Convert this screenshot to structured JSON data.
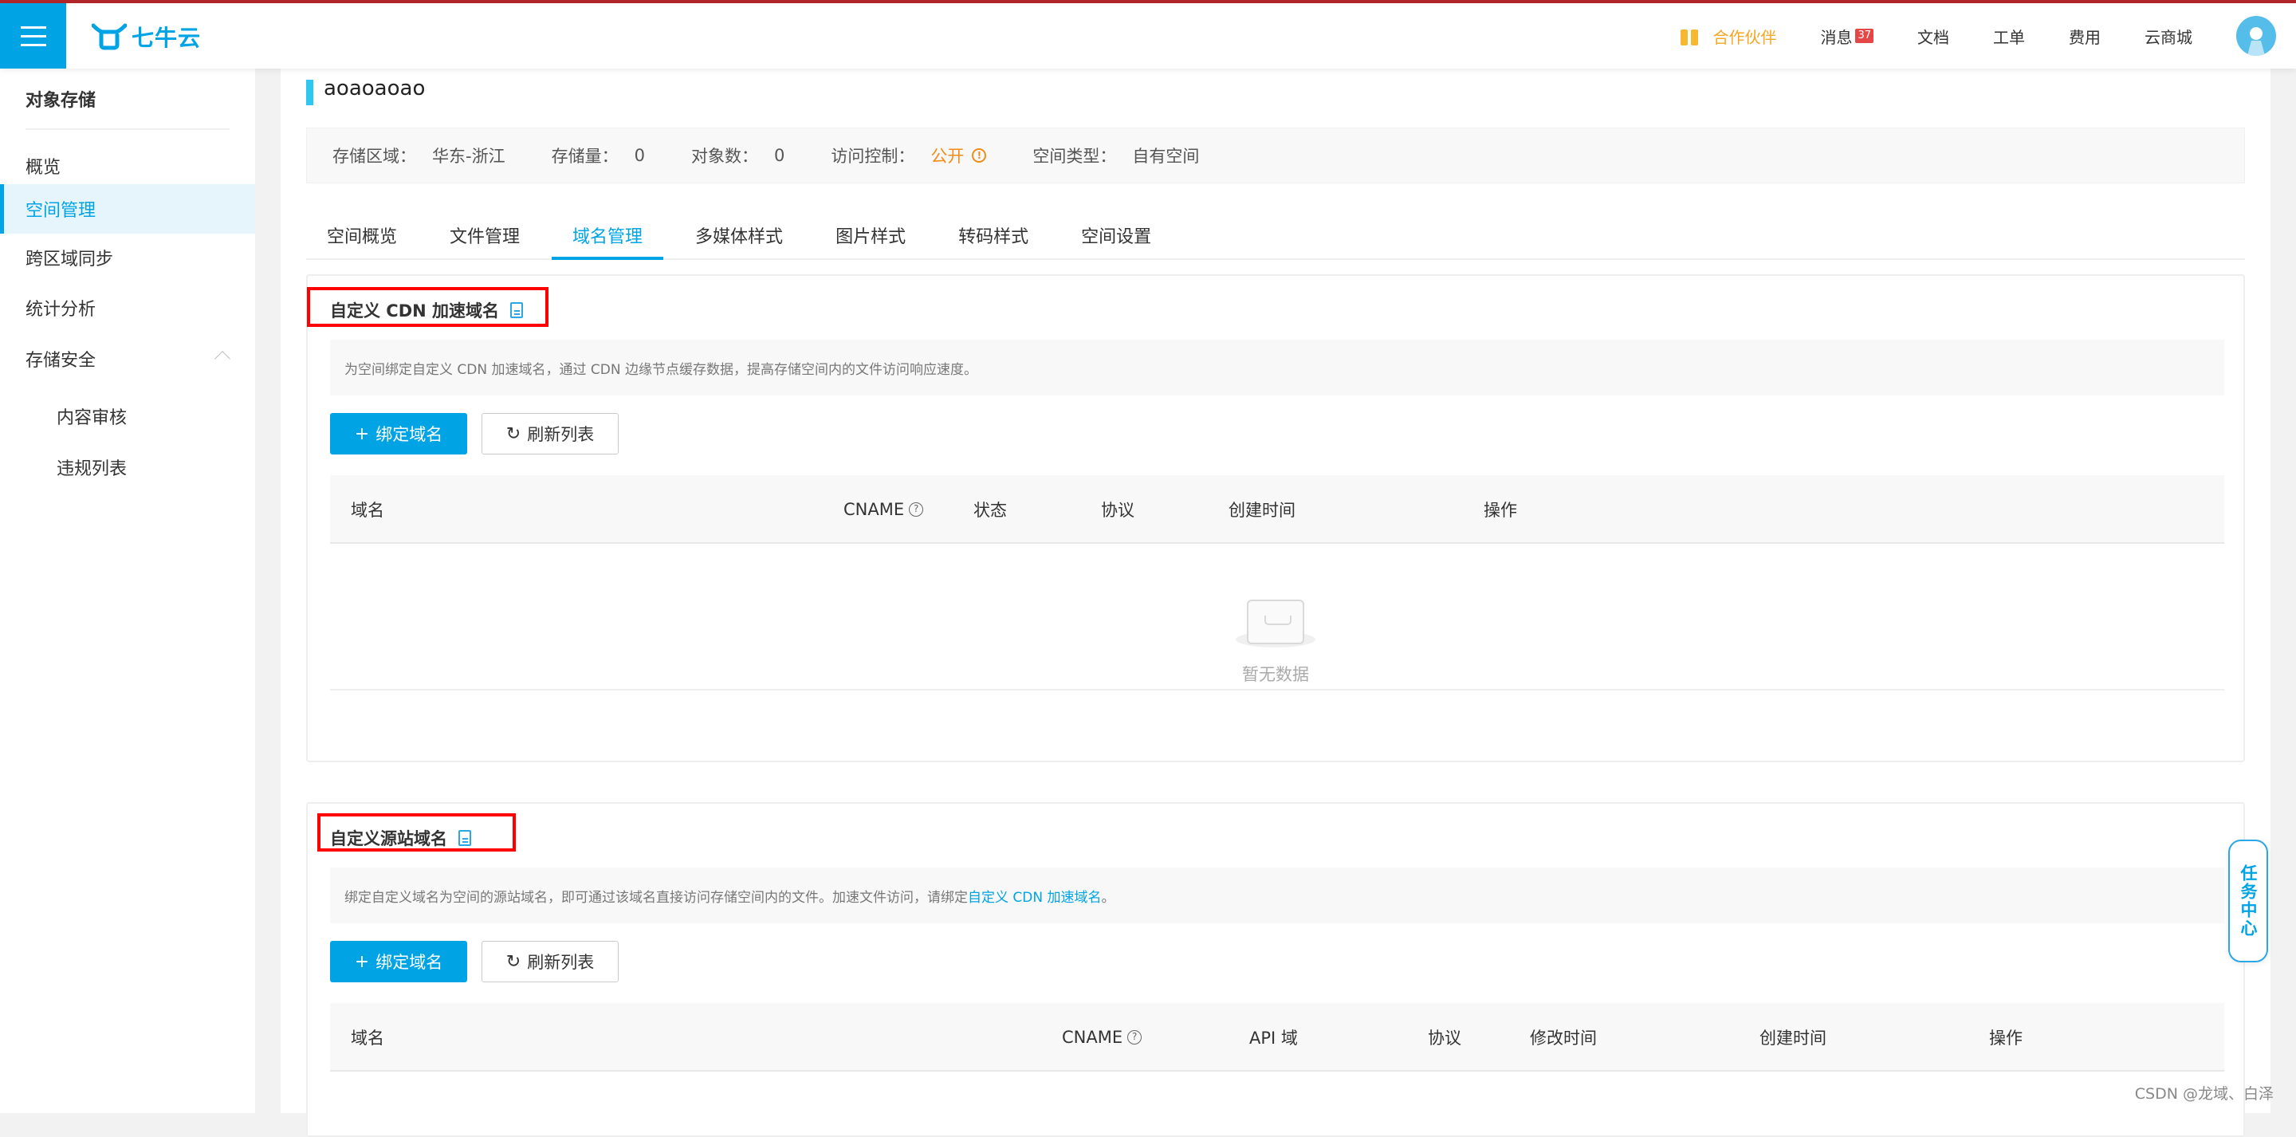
{
  "header": {
    "brand": "七牛云",
    "nav": [
      {
        "label": "合作伙伴",
        "icon": "gift-icon"
      },
      {
        "label": "消息",
        "badge": "37"
      },
      {
        "label": "文档"
      },
      {
        "label": "工单"
      },
      {
        "label": "费用"
      },
      {
        "label": "云商城"
      }
    ],
    "colors": {
      "brand": "#00a4e4",
      "partner": "#f5a623",
      "badge": "#e54646"
    }
  },
  "sidebar": {
    "title": "对象存储",
    "items": [
      {
        "label": "概览"
      },
      {
        "label": "空间管理",
        "active": true
      },
      {
        "label": "跨区域同步"
      },
      {
        "label": "统计分析"
      },
      {
        "label": "存储安全",
        "expanded": true
      },
      {
        "label": "内容审核",
        "sub": true
      },
      {
        "label": "违规列表",
        "sub": true
      }
    ]
  },
  "bucket": {
    "name": "aoaoaoao",
    "info": [
      {
        "label": "存储区域：",
        "value": "华东-浙江"
      },
      {
        "label": "存储量：",
        "value": "0"
      },
      {
        "label": "对象数：",
        "value": "0"
      },
      {
        "label": "访问控制：",
        "value": "公开",
        "highlight": true,
        "icon": "warning-icon"
      },
      {
        "label": "空间类型：",
        "value": "自有空间"
      }
    ]
  },
  "tabs": [
    {
      "label": "空间概览"
    },
    {
      "label": "文件管理"
    },
    {
      "label": "域名管理",
      "active": true
    },
    {
      "label": "多媒体样式"
    },
    {
      "label": "图片样式"
    },
    {
      "label": "转码样式"
    },
    {
      "label": "空间设置"
    }
  ],
  "cdn_section": {
    "title": "自定义 CDN 加速域名",
    "description": "为空间绑定自定义 CDN 加速域名，通过 CDN 边缘节点缓存数据，提高存储空间内的文件访问响应速度。",
    "bind_button": "绑定域名",
    "refresh_button": "刷新列表",
    "columns": [
      "域名",
      "CNAME",
      "状态",
      "协议",
      "创建时间",
      "操作"
    ],
    "rows": [],
    "empty_text": "暂无数据"
  },
  "origin_section": {
    "title": "自定义源站域名",
    "description_prefix": "绑定自定义域名为空间的源站域名，即可通过该域名直接访问存储空间内的文件。加速文件访问，请绑定",
    "description_link": "自定义 CDN 加速域名",
    "description_suffix": "。",
    "bind_button": "绑定域名",
    "refresh_button": "刷新列表",
    "columns": [
      "域名",
      "CNAME",
      "API 域",
      "协议",
      "修改时间",
      "创建时间",
      "操作"
    ]
  },
  "task_center": "任务中心",
  "watermark": "CSDN @龙域、白泽"
}
